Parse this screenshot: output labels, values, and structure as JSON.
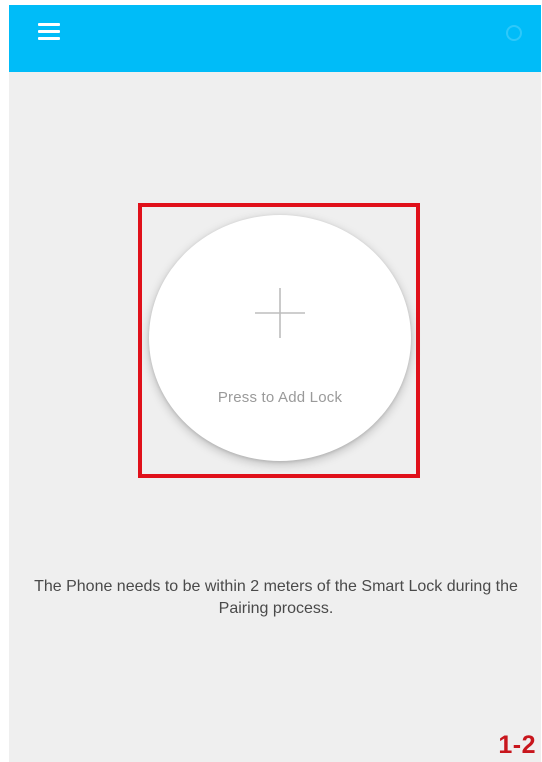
{
  "app_bar": {
    "background_color": "#00bcf8",
    "menu_icon": "hamburger-menu-icon",
    "right_icon": "faint-icon"
  },
  "add_lock": {
    "label": "Press to Add Lock",
    "icon": "plus-icon",
    "highlight_color": "#e0101a"
  },
  "hint": {
    "text": "The Phone needs to be within 2 meters of the Smart Lock during the Pairing process."
  },
  "figure_label": "1-2"
}
